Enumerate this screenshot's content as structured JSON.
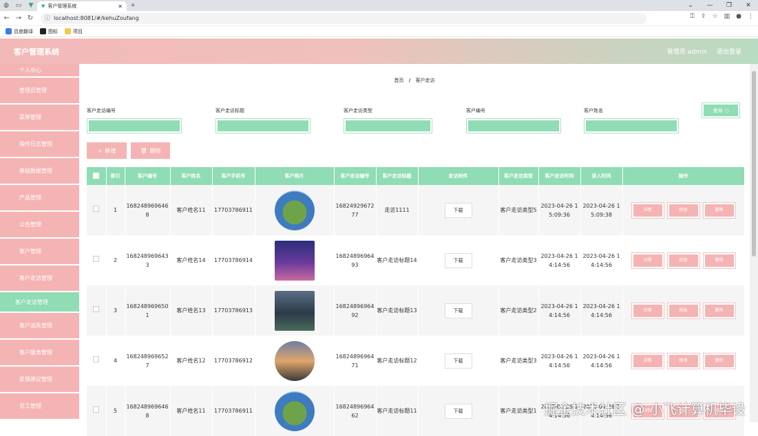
{
  "browser": {
    "tab_title": "客户管理系统",
    "url": "localhost:8081/#/kehuZoufang",
    "bookmarks": [
      "百度翻译",
      "图标",
      "项目"
    ]
  },
  "app": {
    "brand": "客户管理系统",
    "admin_label": "管理员 admin",
    "logout": "退出登录"
  },
  "sidebar": {
    "items": [
      {
        "label": "个人中心"
      },
      {
        "label": "管理员管理"
      },
      {
        "label": "菜单管理"
      },
      {
        "label": "操作日志管理"
      },
      {
        "label": "基础数据管理"
      },
      {
        "label": "产品管理"
      },
      {
        "label": "公告管理"
      },
      {
        "label": "客户管理"
      },
      {
        "label": "客户走访管理"
      },
      {
        "label": "客户走访管理"
      },
      {
        "label": "客户流失管理"
      },
      {
        "label": "客户服务管理"
      },
      {
        "label": "反馈建议管理"
      },
      {
        "label": "员工管理"
      }
    ]
  },
  "breadcrumb": {
    "home": "首页",
    "sep": "/",
    "current": "客户走访"
  },
  "filters": {
    "f1": "客户走访编号",
    "f2": "客户走访标题",
    "f3": "客户走访类型",
    "f4": "客户编号",
    "f5": "客户姓名",
    "search": "查询"
  },
  "actions": {
    "add": "新增",
    "del": "删除"
  },
  "table": {
    "headers": [
      "索引",
      "客户编号",
      "客户姓名",
      "客户手机号",
      "客户照片",
      "客户走访编号",
      "客户走访标题",
      "走访附件",
      "客户走访类型",
      "客户走访时间",
      "录入时间",
      "操作"
    ],
    "download": "下载",
    "op_detail": "详情",
    "op_edit": "修改",
    "op_delete": "删除",
    "rows": [
      {
        "idx": "1",
        "cno": "1682489696468",
        "name": "客户姓名11",
        "phone": "17703786911",
        "vno": "1682492967277",
        "title": "走访1111",
        "type": "客户走访类型5",
        "vtime": "2023-04-26 15:09:36",
        "ctime": "2023-04-26 15:09:38"
      },
      {
        "idx": "2",
        "cno": "1682489696433",
        "name": "客户姓名14",
        "phone": "17703786914",
        "vno": "1682489696493",
        "title": "客户走访标题14",
        "type": "客户走访类型3",
        "vtime": "2023-04-26 14:14:56",
        "ctime": "2023-04-26 14:14:56"
      },
      {
        "idx": "3",
        "cno": "1682489696501",
        "name": "客户姓名13",
        "phone": "17703786913",
        "vno": "1682489696492",
        "title": "客户走访标题13",
        "type": "客户走访类型2",
        "vtime": "2023-04-26 14:14:56",
        "ctime": "2023-04-26 14:14:56"
      },
      {
        "idx": "4",
        "cno": "1682489696527",
        "name": "客户姓名12",
        "phone": "17703786912",
        "vno": "1682489696471",
        "title": "客户走访标题12",
        "type": "客户走访类型3",
        "vtime": "2023-04-26 14:14:56",
        "ctime": "2023-04-26 14:14:56"
      },
      {
        "idx": "5",
        "cno": "1682489696468",
        "name": "客户姓名11",
        "phone": "17703786911",
        "vno": "1682489696462",
        "title": "客户走访标题11",
        "type": "客户走访类型1",
        "vtime": "2023-04-26 14:14:56",
        "ctime": "2023-04-26 14:14:56"
      }
    ]
  },
  "watermark": "掘金技术社区 @ 小飞计算机毕设"
}
